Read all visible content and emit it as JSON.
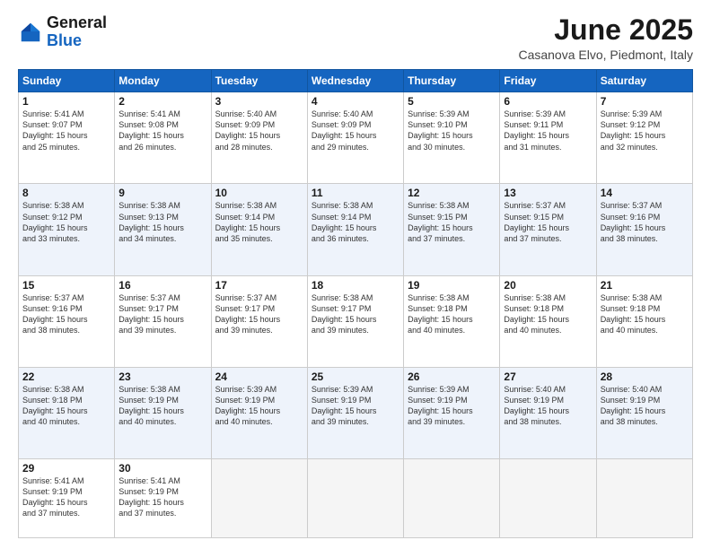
{
  "header": {
    "logo_general": "General",
    "logo_blue": "Blue",
    "title": "June 2025",
    "subtitle": "Casanova Elvo, Piedmont, Italy"
  },
  "columns": [
    "Sunday",
    "Monday",
    "Tuesday",
    "Wednesday",
    "Thursday",
    "Friday",
    "Saturday"
  ],
  "rows": [
    [
      {
        "day": "1",
        "info": "Sunrise: 5:41 AM\nSunset: 9:07 PM\nDaylight: 15 hours\nand 25 minutes."
      },
      {
        "day": "2",
        "info": "Sunrise: 5:41 AM\nSunset: 9:08 PM\nDaylight: 15 hours\nand 26 minutes."
      },
      {
        "day": "3",
        "info": "Sunrise: 5:40 AM\nSunset: 9:09 PM\nDaylight: 15 hours\nand 28 minutes."
      },
      {
        "day": "4",
        "info": "Sunrise: 5:40 AM\nSunset: 9:09 PM\nDaylight: 15 hours\nand 29 minutes."
      },
      {
        "day": "5",
        "info": "Sunrise: 5:39 AM\nSunset: 9:10 PM\nDaylight: 15 hours\nand 30 minutes."
      },
      {
        "day": "6",
        "info": "Sunrise: 5:39 AM\nSunset: 9:11 PM\nDaylight: 15 hours\nand 31 minutes."
      },
      {
        "day": "7",
        "info": "Sunrise: 5:39 AM\nSunset: 9:12 PM\nDaylight: 15 hours\nand 32 minutes."
      }
    ],
    [
      {
        "day": "8",
        "info": "Sunrise: 5:38 AM\nSunset: 9:12 PM\nDaylight: 15 hours\nand 33 minutes."
      },
      {
        "day": "9",
        "info": "Sunrise: 5:38 AM\nSunset: 9:13 PM\nDaylight: 15 hours\nand 34 minutes."
      },
      {
        "day": "10",
        "info": "Sunrise: 5:38 AM\nSunset: 9:14 PM\nDaylight: 15 hours\nand 35 minutes."
      },
      {
        "day": "11",
        "info": "Sunrise: 5:38 AM\nSunset: 9:14 PM\nDaylight: 15 hours\nand 36 minutes."
      },
      {
        "day": "12",
        "info": "Sunrise: 5:38 AM\nSunset: 9:15 PM\nDaylight: 15 hours\nand 37 minutes."
      },
      {
        "day": "13",
        "info": "Sunrise: 5:37 AM\nSunset: 9:15 PM\nDaylight: 15 hours\nand 37 minutes."
      },
      {
        "day": "14",
        "info": "Sunrise: 5:37 AM\nSunset: 9:16 PM\nDaylight: 15 hours\nand 38 minutes."
      }
    ],
    [
      {
        "day": "15",
        "info": "Sunrise: 5:37 AM\nSunset: 9:16 PM\nDaylight: 15 hours\nand 38 minutes."
      },
      {
        "day": "16",
        "info": "Sunrise: 5:37 AM\nSunset: 9:17 PM\nDaylight: 15 hours\nand 39 minutes."
      },
      {
        "day": "17",
        "info": "Sunrise: 5:37 AM\nSunset: 9:17 PM\nDaylight: 15 hours\nand 39 minutes."
      },
      {
        "day": "18",
        "info": "Sunrise: 5:38 AM\nSunset: 9:17 PM\nDaylight: 15 hours\nand 39 minutes."
      },
      {
        "day": "19",
        "info": "Sunrise: 5:38 AM\nSunset: 9:18 PM\nDaylight: 15 hours\nand 40 minutes."
      },
      {
        "day": "20",
        "info": "Sunrise: 5:38 AM\nSunset: 9:18 PM\nDaylight: 15 hours\nand 40 minutes."
      },
      {
        "day": "21",
        "info": "Sunrise: 5:38 AM\nSunset: 9:18 PM\nDaylight: 15 hours\nand 40 minutes."
      }
    ],
    [
      {
        "day": "22",
        "info": "Sunrise: 5:38 AM\nSunset: 9:18 PM\nDaylight: 15 hours\nand 40 minutes."
      },
      {
        "day": "23",
        "info": "Sunrise: 5:38 AM\nSunset: 9:19 PM\nDaylight: 15 hours\nand 40 minutes."
      },
      {
        "day": "24",
        "info": "Sunrise: 5:39 AM\nSunset: 9:19 PM\nDaylight: 15 hours\nand 40 minutes."
      },
      {
        "day": "25",
        "info": "Sunrise: 5:39 AM\nSunset: 9:19 PM\nDaylight: 15 hours\nand 39 minutes."
      },
      {
        "day": "26",
        "info": "Sunrise: 5:39 AM\nSunset: 9:19 PM\nDaylight: 15 hours\nand 39 minutes."
      },
      {
        "day": "27",
        "info": "Sunrise: 5:40 AM\nSunset: 9:19 PM\nDaylight: 15 hours\nand 38 minutes."
      },
      {
        "day": "28",
        "info": "Sunrise: 5:40 AM\nSunset: 9:19 PM\nDaylight: 15 hours\nand 38 minutes."
      }
    ],
    [
      {
        "day": "29",
        "info": "Sunrise: 5:41 AM\nSunset: 9:19 PM\nDaylight: 15 hours\nand 37 minutes."
      },
      {
        "day": "30",
        "info": "Sunrise: 5:41 AM\nSunset: 9:19 PM\nDaylight: 15 hours\nand 37 minutes."
      },
      {
        "day": "",
        "info": ""
      },
      {
        "day": "",
        "info": ""
      },
      {
        "day": "",
        "info": ""
      },
      {
        "day": "",
        "info": ""
      },
      {
        "day": "",
        "info": ""
      }
    ]
  ]
}
